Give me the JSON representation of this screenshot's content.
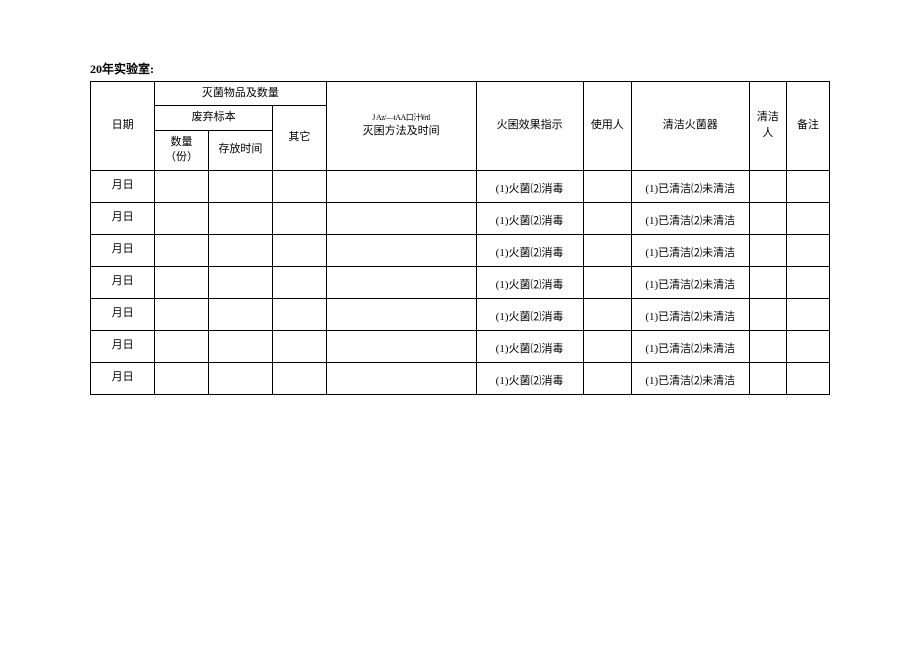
{
  "header": {
    "title": "20年实验室:"
  },
  "table": {
    "headers": {
      "date": "日期",
      "sterilize_items": "灭菌物品及数量",
      "discard_sample": "废弃标本",
      "qty": "数量（份）",
      "storage_time": "存放时间",
      "other": "其它",
      "method_small": "J Az/—tAA口汁¥rtl",
      "method": "灭囷方法及时间",
      "effect": "火囷效果指示",
      "user": "使用人",
      "clean_sterilizer": "清洁火菌器",
      "clean_person": "清洁人",
      "remark": "备注"
    },
    "rows": [
      {
        "date": "月日",
        "effect": "(1)火菌⑵消毒",
        "cleaner": "(1)已清洁⑵未清洁"
      },
      {
        "date": "月日",
        "effect": "(1)火菌⑵消毒",
        "cleaner": "(1)已清洁⑵未清洁"
      },
      {
        "date": "月日",
        "effect": "(1)火菌⑵消毒",
        "cleaner": "(1)已清洁⑵未清洁"
      },
      {
        "date": "月日",
        "effect": "(1)火菌⑵消毒",
        "cleaner": "(1)已清洁⑵未清洁"
      },
      {
        "date": "月日",
        "effect": "(1)火菌⑵消毒",
        "cleaner": "(1)已清洁⑵未清洁"
      },
      {
        "date": "月日",
        "effect": "(1)火菌⑵消毒",
        "cleaner": "(1)已清洁⑵未清洁"
      },
      {
        "date": "月日",
        "effect": "(1)火菌⑵消毒",
        "cleaner": "(1)已清洁⑵未清洁"
      }
    ]
  }
}
